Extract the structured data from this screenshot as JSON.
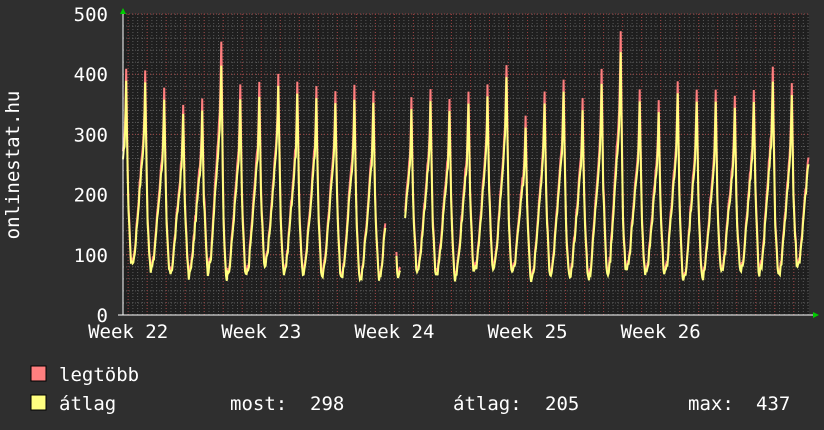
{
  "chart_data": {
    "type": "line",
    "ylabel": "onlinestat.hu",
    "xlabel": "",
    "title": "",
    "ylim": [
      0,
      500
    ],
    "yticks": [
      "0",
      "100",
      "200",
      "300",
      "400",
      "500"
    ],
    "xticks": [
      "Week 22",
      "Week 23",
      "Week 24",
      "Week 25",
      "Week 26"
    ],
    "x_unit": "days since start of Week 22",
    "xlim": [
      -0.27,
      35.8
    ],
    "grid": true,
    "grid_style": "dotted",
    "colors": {
      "background": "#2f2f2f",
      "plot_background": "#1f1f1f",
      "grid_major": "#9a4040",
      "grid_minor": "#5a5a5a",
      "axis": "#ffffff",
      "arrow": "#00cc00"
    },
    "series": [
      {
        "name": "legtöbb",
        "color": "#ff7f7f",
        "daily_min": [
          85,
          75,
          70,
          68,
          72,
          62,
          65,
          82,
          72,
          70,
          68,
          62,
          58,
          60,
          70,
          75,
          68,
          65,
          70,
          75,
          72,
          62,
          70,
          65,
          60,
          68,
          72,
          70,
          65,
          58,
          62,
          75,
          72,
          68,
          65,
          80
        ],
        "daily_max": [
          405,
          375,
          350,
          365,
          460,
          380,
          390,
          405,
          385,
          385,
          380,
          385,
          370,
          385,
          360,
          370,
          360,
          370,
          380,
          420,
          335,
          375,
          390,
          360,
          410,
          470,
          375,
          360,
          390,
          380,
          370,
          360,
          375,
          420,
          380,
          380
        ]
      },
      {
        "name": "átlag",
        "color": "#ffff80",
        "daily_min": [
          80,
          70,
          65,
          62,
          68,
          58,
          60,
          78,
          68,
          65,
          62,
          58,
          55,
          58,
          65,
          70,
          62,
          60,
          65,
          70,
          68,
          58,
          65,
          60,
          55,
          62,
          68,
          65,
          60,
          55,
          58,
          70,
          68,
          62,
          60,
          75
        ],
        "daily_max": [
          385,
          355,
          335,
          345,
          420,
          355,
          365,
          385,
          365,
          365,
          360,
          360,
          350,
          365,
          340,
          350,
          340,
          350,
          360,
          400,
          315,
          355,
          370,
          340,
          385,
          435,
          355,
          340,
          370,
          360,
          350,
          340,
          355,
          395,
          360,
          365
        ]
      }
    ],
    "gaps": [
      {
        "from": 13.55,
        "to": 14.1
      },
      {
        "from": 14.35,
        "to": 14.55
      }
    ]
  },
  "legend": {
    "items": [
      {
        "label": "legtöbb",
        "color": "#ff7f7f"
      },
      {
        "label": "átlag",
        "color": "#ffff80"
      }
    ],
    "stats": {
      "now_label": "most:",
      "now_value": "298",
      "avg_label": "átlag:",
      "avg_value": "205",
      "max_label": "max:",
      "max_value": "437"
    }
  }
}
